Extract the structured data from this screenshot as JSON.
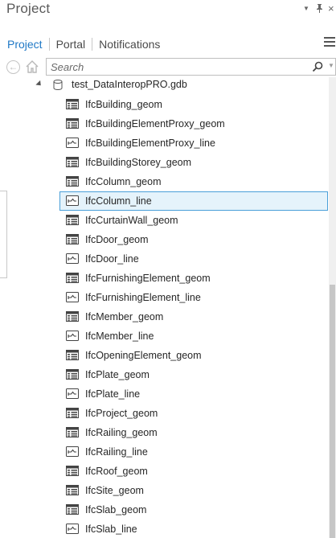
{
  "pane": {
    "title": "Project",
    "controls": [
      "pin-dropdown-icon",
      "pin-icon",
      "close-icon"
    ]
  },
  "tabs": [
    {
      "label": "Project",
      "active": true
    },
    {
      "label": "Portal",
      "active": false
    },
    {
      "label": "Notifications",
      "active": false
    }
  ],
  "search": {
    "placeholder": "Search",
    "value": ""
  },
  "tree": {
    "database": {
      "label": "test_DataInteropPRO.gdb",
      "expanded": true
    },
    "items": [
      {
        "label": "IfcBuilding_geom",
        "type": "polygon",
        "selected": false
      },
      {
        "label": "IfcBuildingElementProxy_geom",
        "type": "polygon",
        "selected": false
      },
      {
        "label": "IfcBuildingElementProxy_line",
        "type": "line",
        "selected": false
      },
      {
        "label": "IfcBuildingStorey_geom",
        "type": "polygon",
        "selected": false
      },
      {
        "label": "IfcColumn_geom",
        "type": "polygon",
        "selected": false
      },
      {
        "label": "IfcColumn_line",
        "type": "line",
        "selected": true
      },
      {
        "label": "IfcCurtainWall_geom",
        "type": "polygon",
        "selected": false
      },
      {
        "label": "IfcDoor_geom",
        "type": "polygon",
        "selected": false
      },
      {
        "label": "IfcDoor_line",
        "type": "line",
        "selected": false
      },
      {
        "label": "IfcFurnishingElement_geom",
        "type": "polygon",
        "selected": false
      },
      {
        "label": "IfcFurnishingElement_line",
        "type": "line",
        "selected": false
      },
      {
        "label": "IfcMember_geom",
        "type": "polygon",
        "selected": false
      },
      {
        "label": "IfcMember_line",
        "type": "line",
        "selected": false
      },
      {
        "label": "IfcOpeningElement_geom",
        "type": "polygon",
        "selected": false
      },
      {
        "label": "IfcPlate_geom",
        "type": "polygon",
        "selected": false
      },
      {
        "label": "IfcPlate_line",
        "type": "line",
        "selected": false
      },
      {
        "label": "IfcProject_geom",
        "type": "polygon",
        "selected": false
      },
      {
        "label": "IfcRailing_geom",
        "type": "polygon",
        "selected": false
      },
      {
        "label": "IfcRailing_line",
        "type": "line",
        "selected": false
      },
      {
        "label": "IfcRoof_geom",
        "type": "polygon",
        "selected": false
      },
      {
        "label": "IfcSite_geom",
        "type": "polygon",
        "selected": false
      },
      {
        "label": "IfcSlab_geom",
        "type": "polygon",
        "selected": false
      },
      {
        "label": "IfcSlab_line",
        "type": "line",
        "selected": false
      }
    ]
  },
  "colors": {
    "accent": "#1f78c6",
    "selection_border": "#4a9fd8",
    "selection_fill": "#e5f3fb"
  }
}
